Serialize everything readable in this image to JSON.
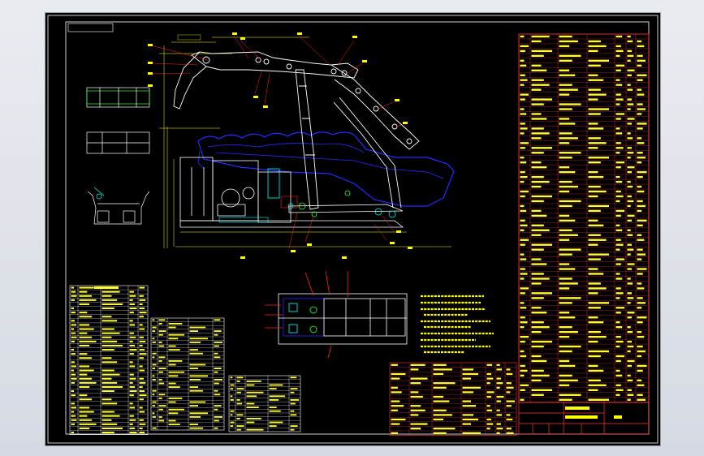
{
  "drawing": {
    "title_tab": "",
    "tech_req_title": "",
    "colors": {
      "frame": "#ffffff",
      "table": "#ff3333",
      "table_alt": "#a81c1c",
      "text": "#ffff33",
      "part_blue": "#2a2aff",
      "part_white": "#ffffff",
      "part_cyan": "#00ffff",
      "part_green": "#33ff33",
      "part_red": "#ff2222"
    }
  }
}
